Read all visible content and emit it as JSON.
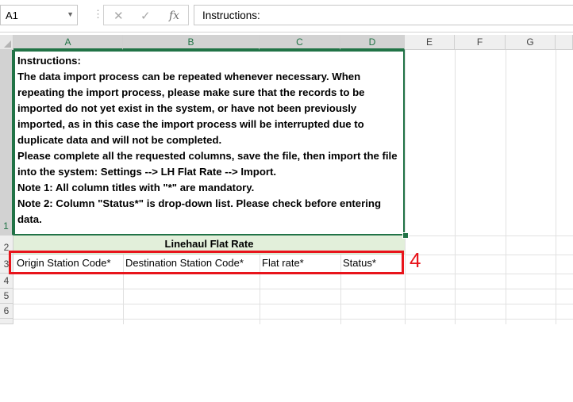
{
  "formula_bar": {
    "name_box": "A1",
    "cancel_icon": "✕",
    "enter_icon": "✓",
    "function_icon": "fx",
    "formula_value": "Instructions:"
  },
  "columns": [
    "A",
    "B",
    "C",
    "D",
    "E",
    "F",
    "G"
  ],
  "rows": [
    "1",
    "2",
    "3",
    "4",
    "5",
    "6"
  ],
  "cells": {
    "A1": "Instructions:\nThe data import process can be repeated whenever necessary. When repeating the import process, please make sure that the records to be imported do not yet exist in the system, or have not been previously imported, as in this case the import process will be interrupted due to duplicate data and will not be completed.\nPlease complete all the requested columns, save the file, then import the file into the system: Settings --> LH Flat Rate --> Import.\nNote 1: All column titles with \"*\" are mandatory.\nNote 2: Column \"Status*\" is drop-down list. Please check before entering data.",
    "A2": "Linehaul Flat Rate",
    "A3": "Origin Station Code*",
    "B3": "Destination Station Code*",
    "C3": "Flat rate*",
    "D3": "Status*"
  },
  "annotation": {
    "label": "4",
    "color": "#e8141b"
  },
  "colors": {
    "selection": "#217346",
    "title_fill": "#e2efda"
  }
}
